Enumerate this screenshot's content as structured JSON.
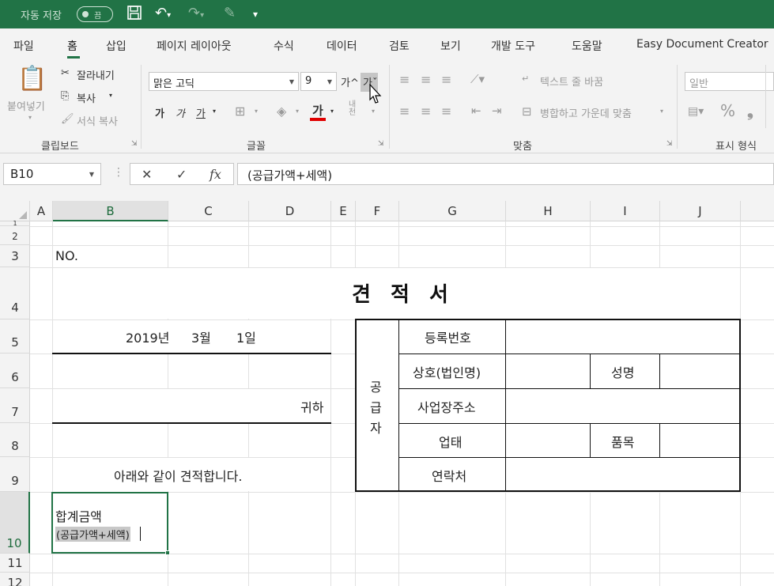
{
  "titlebar": {
    "autosave_label": "자동 저장",
    "autosave_state": "끔"
  },
  "tabs": [
    "파일",
    "홈",
    "삽입",
    "페이지 레이아웃",
    "수식",
    "데이터",
    "검토",
    "보기",
    "개발 도구",
    "도움말",
    "Easy Document Creator"
  ],
  "ribbon": {
    "clipboard": {
      "paste": "붙여넣기",
      "cut": "잘라내기",
      "copy": "복사",
      "format_painter": "서식 복사",
      "label": "클립보드"
    },
    "font": {
      "font_name": "맑은 고딕",
      "font_size": "9",
      "grow": "가^",
      "shrink": "가ˇ",
      "bold": "가",
      "italic": "가",
      "underline": "가",
      "font_color_glyph": "가",
      "phonetic": "내천",
      "label": "글꼴"
    },
    "alignment": {
      "wrap_text": "텍스트 줄 바꿈",
      "merge_center": "병합하고 가운데 맞춤",
      "label": "맞춤"
    },
    "number": {
      "format": "일반",
      "percent": "%",
      "comma": "❟",
      "label": "표시 형식"
    }
  },
  "formula_bar": {
    "name_box": "B10",
    "cancel": "✕",
    "enter": "✓",
    "fx": "fx",
    "formula": "(공급가액+세액)"
  },
  "columns": [
    "A",
    "B",
    "C",
    "D",
    "E",
    "F",
    "G",
    "H",
    "I",
    "J"
  ],
  "rows": [
    "1",
    "2",
    "3",
    "4",
    "5",
    "6",
    "7",
    "8",
    "9",
    "10",
    "11",
    "12"
  ],
  "sheet": {
    "no_label": "NO.",
    "title": "견 적 서",
    "date": {
      "year": "2019년",
      "month": "3월",
      "day": "1일"
    },
    "to_suffix": "귀하",
    "intro": "아래와 같이 견적합니다.",
    "total_label": "합계금액",
    "total_note": "(공급가액+세액)",
    "supplier_label": [
      "공",
      "급",
      "자"
    ],
    "supplier_fields": {
      "reg_no": "등록번호",
      "company": "상호(법인명)",
      "name": "성명",
      "address": "사업장주소",
      "business_type": "업태",
      "item": "품목",
      "contact": "연락처"
    }
  },
  "colors": {
    "accent": "#217346",
    "ribbon_bg": "#f3f3f3",
    "font_color_bar": "#e00000"
  }
}
